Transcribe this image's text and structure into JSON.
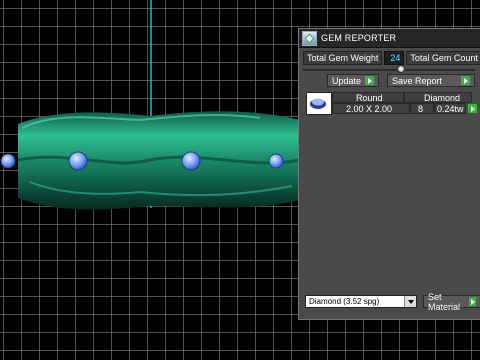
{
  "panel": {
    "title": "GEM REPORTER",
    "total_weight_label": "Total Gem Weight",
    "total_weight_value": "24",
    "total_count_label": "Total Gem Count",
    "update_label": "Update",
    "save_report_label": "Save Report",
    "table": {
      "headers": [
        "Round",
        "Diamond"
      ],
      "rows": [
        {
          "shape": "2.00 X 2.00",
          "count": "8",
          "weight": "0.24tw"
        }
      ]
    },
    "material_value": "Diamond     (3.52 spg)",
    "set_material_label": "Set Material"
  },
  "colors": {
    "ring": "#1f8f6e",
    "gem": "#7aa6ff",
    "axis": "#29b6d8",
    "accent_button": "#3cb43c",
    "value_text": "#59e8ff"
  }
}
